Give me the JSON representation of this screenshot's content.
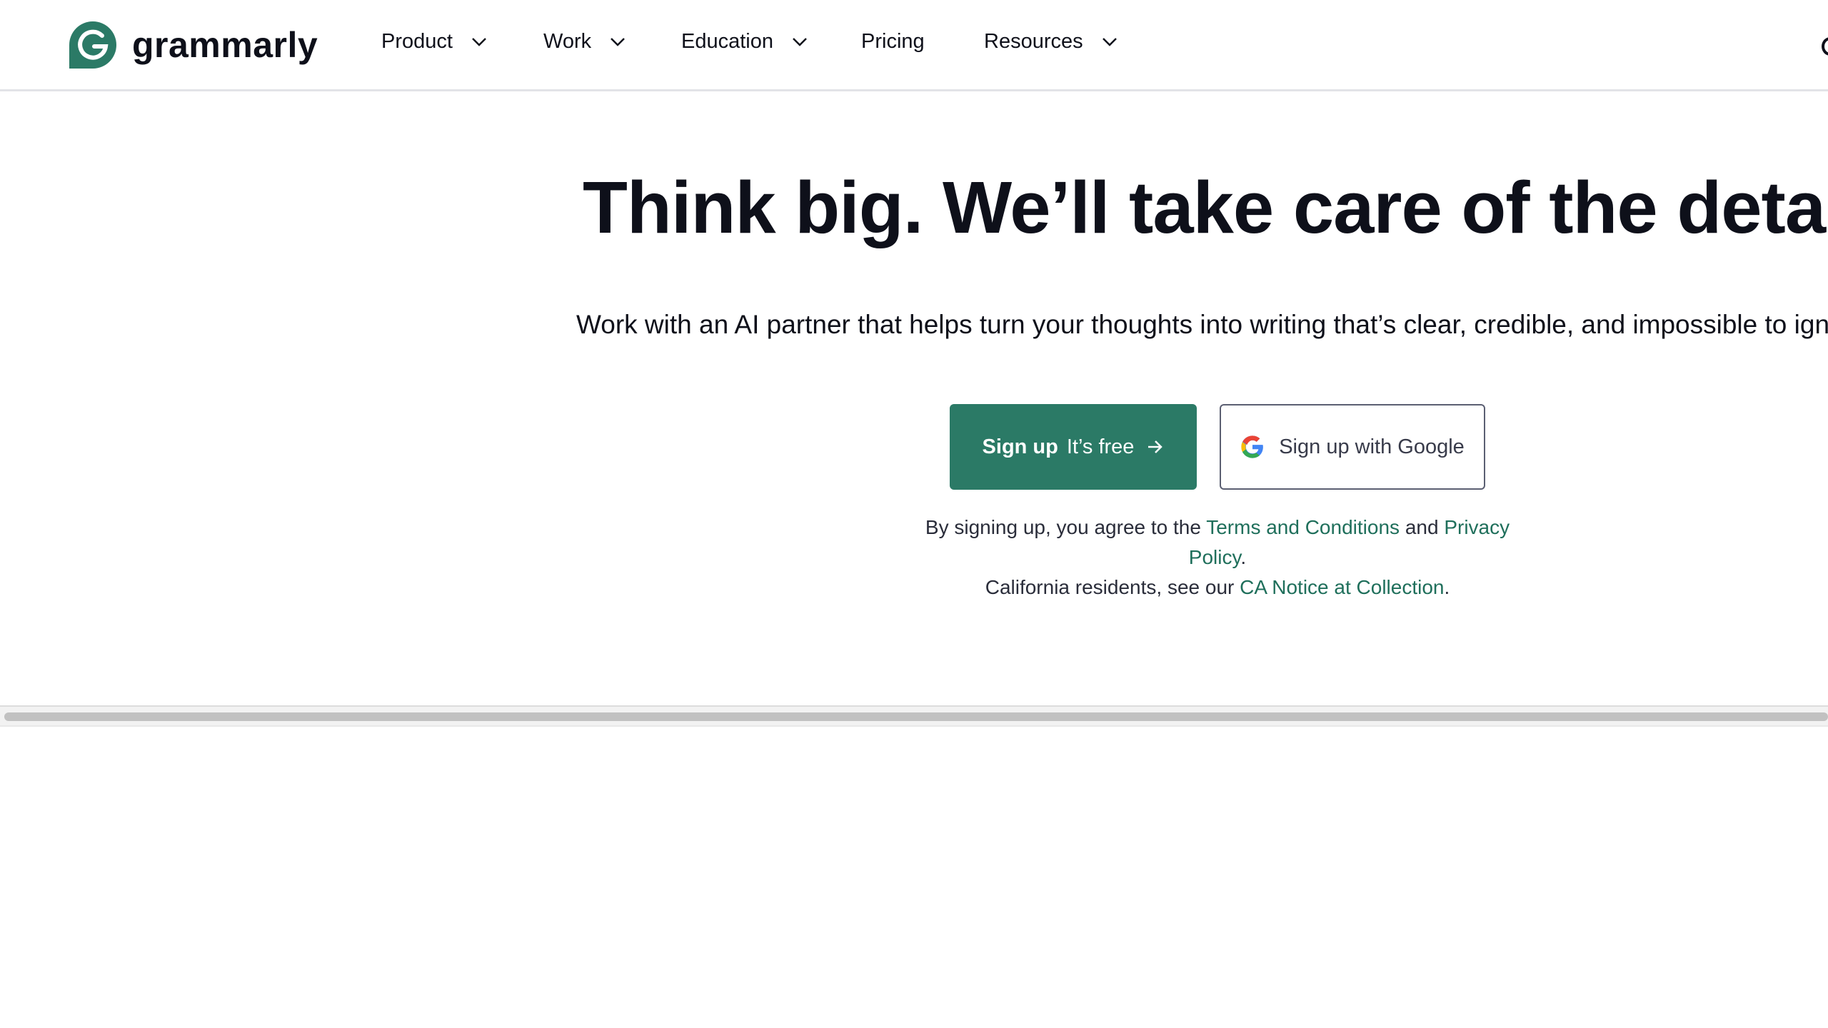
{
  "header": {
    "brand": "grammarly",
    "nav": [
      {
        "label": "Product",
        "has_dropdown": true
      },
      {
        "label": "Work",
        "has_dropdown": true
      },
      {
        "label": "Education",
        "has_dropdown": true
      },
      {
        "label": "Pricing",
        "has_dropdown": false
      },
      {
        "label": "Resources",
        "has_dropdown": true
      }
    ]
  },
  "hero": {
    "title": "Think big. We’ll take care of the details",
    "subtitle": "Work with an AI partner that helps turn your thoughts into writing that’s clear, credible, and impossible to igno"
  },
  "cta": {
    "signup_strong": "Sign up",
    "signup_rest": "It’s free",
    "google_label": "Sign up with Google"
  },
  "legal": {
    "line1_prefix": "By signing up, you agree to the",
    "terms_link": "Terms and Conditions",
    "and": "and",
    "privacy_link": "Privacy Policy",
    "line2_prefix": "California residents, see our",
    "ca_notice_link": "CA Notice at Collection",
    "period": "."
  },
  "colors": {
    "brand_green": "#2b7a66",
    "link_green": "#1f6f5b",
    "text_dark": "#0e101a"
  },
  "icons": {
    "logo": "grammarly-g-icon",
    "dropdown": "chevron-down-icon",
    "arrow": "arrow-right-icon",
    "google": "google-g-icon"
  }
}
